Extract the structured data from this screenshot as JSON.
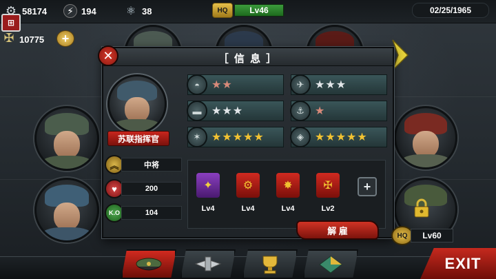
{
  "top_bar": {
    "resource_1": "58174",
    "resource_2": "194",
    "resource_3": "38",
    "hq_label": "HQ",
    "hq_level": "Lv46",
    "date": "02/25/1965",
    "gold": "10775"
  },
  "dialog": {
    "title": "［ 信 息 ］",
    "close_glyph": "✕",
    "commander_name": "苏联指挥官",
    "stats": [
      {
        "icon": "rank-chevron-icon",
        "value": "中将"
      },
      {
        "icon": "heart-icon",
        "value": "200"
      },
      {
        "icon": "ko-helmet-icon",
        "value": "104"
      }
    ],
    "skills": [
      {
        "icon": "infantry-helmet-icon",
        "stars": 2,
        "tier": "bronze"
      },
      {
        "icon": "aircraft-icon",
        "stars": 3,
        "tier": "silver"
      },
      {
        "icon": "tank-icon",
        "stars": 3,
        "tier": "silver"
      },
      {
        "icon": "anchor-icon",
        "stars": 1,
        "tier": "bronze"
      },
      {
        "icon": "artillery-icon",
        "stars": 5,
        "tier": "gold"
      },
      {
        "icon": "fortification-icon",
        "stars": 5,
        "tier": "gold"
      }
    ],
    "medals": [
      {
        "name": "medal-purple",
        "level": "Lv4"
      },
      {
        "name": "medal-gear",
        "level": "Lv4"
      },
      {
        "name": "medal-cannon",
        "level": "Lv4"
      },
      {
        "name": "medal-wings",
        "level": "Lv2"
      }
    ],
    "add_medal": "+",
    "dismiss_label": "解 雇"
  },
  "locked_slot": {
    "hq_label": "HQ",
    "level": "Lv60"
  },
  "exit_label": "EXIT",
  "colors": {
    "accent_red": "#c5291e",
    "star_gold": "#f2c232",
    "hq_green": "#3c9a3c"
  }
}
